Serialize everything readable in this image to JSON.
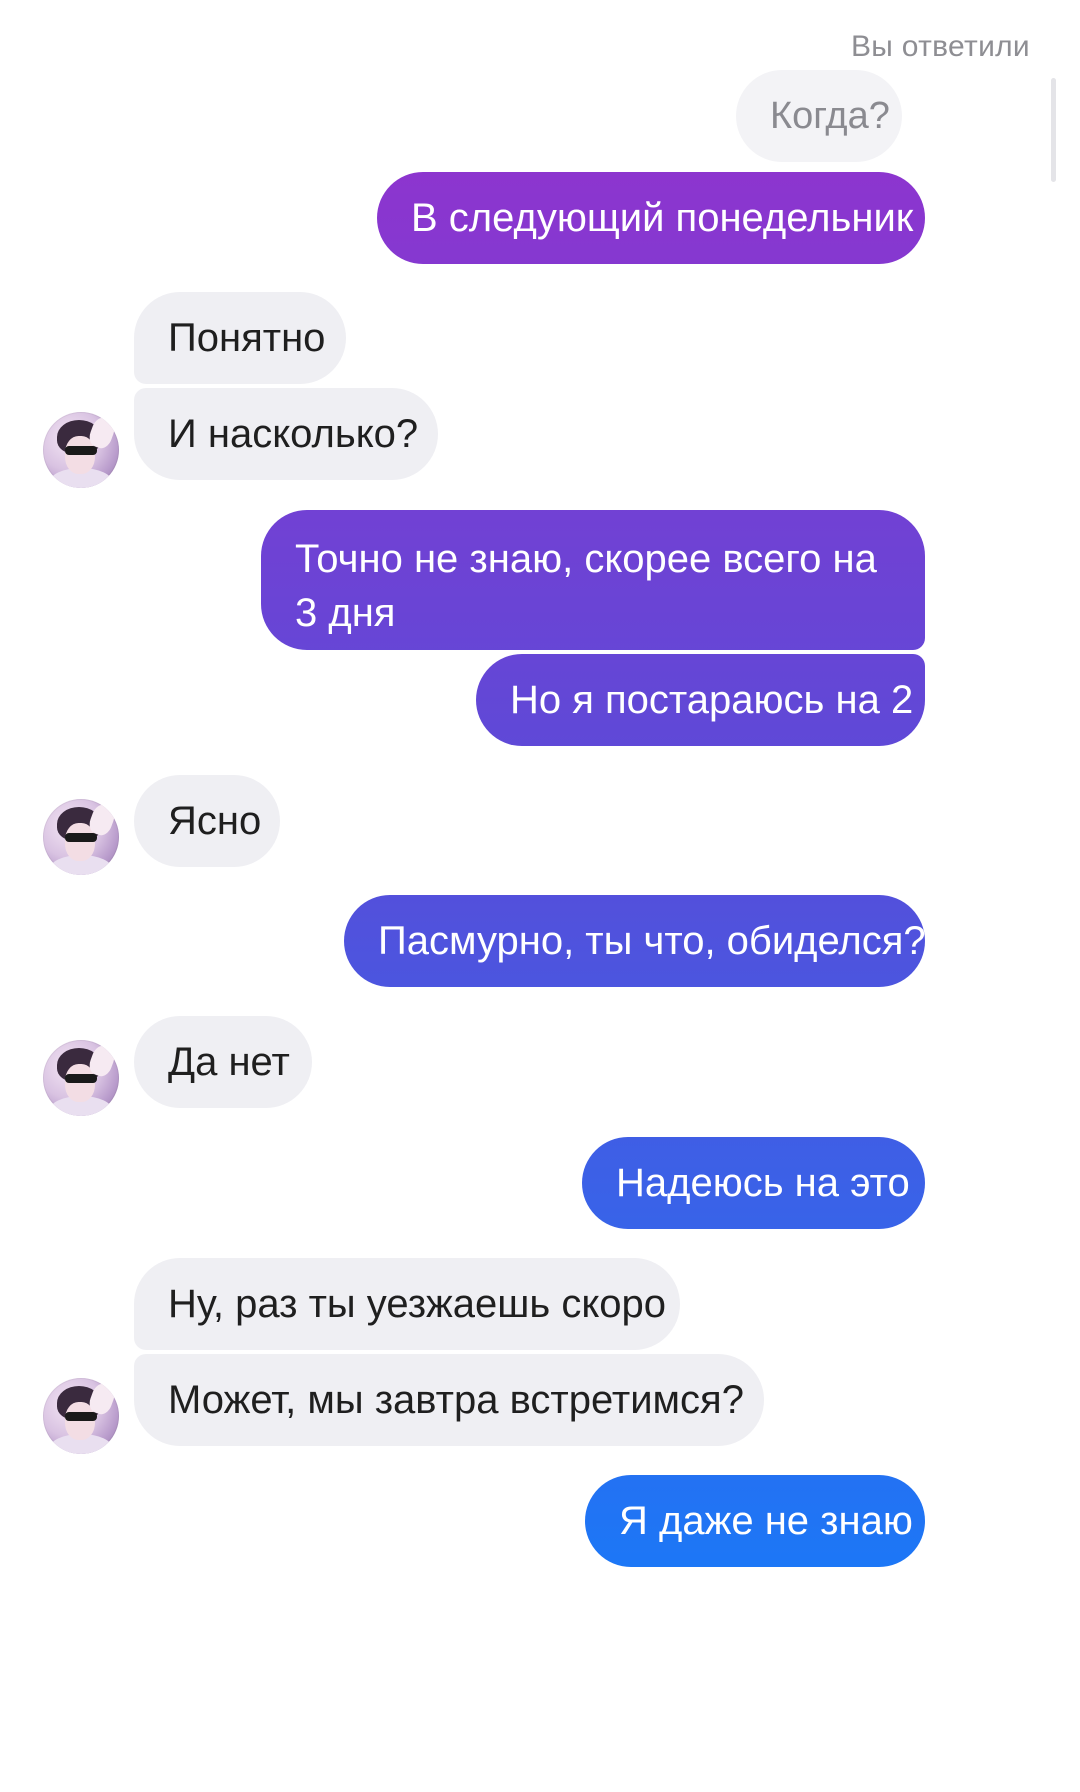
{
  "chat": {
    "reply_note": "Вы ответили",
    "quoted_message": "Когда?",
    "messages": [
      {
        "from": "me",
        "text": "В следующий понедельник"
      },
      {
        "from": "them",
        "text": "Понятно"
      },
      {
        "from": "them",
        "text": "И насколько?"
      },
      {
        "from": "me",
        "text": "Точно не знаю, скорее всего на 3 дня"
      },
      {
        "from": "me",
        "text": "Но я постараюсь на 2"
      },
      {
        "from": "them",
        "text": "Ясно"
      },
      {
        "from": "me",
        "text": "Пасмурно, ты что, обиделся?"
      },
      {
        "from": "them",
        "text": "Да нет"
      },
      {
        "from": "me",
        "text": "Надеюсь на это"
      },
      {
        "from": "them",
        "text": "Ну, раз ты уезжаешь скоро"
      },
      {
        "from": "them",
        "text": "Может, мы завтра встретимся?"
      },
      {
        "from": "me",
        "text": "Я даже не знаю"
      }
    ]
  },
  "colors": {
    "incoming_bubble": "#efeff3",
    "outgoing_gradient_top": "#9a2fcc",
    "outgoing_gradient_mid": "#5a4bd8",
    "outgoing_gradient_bottom": "#0a84ff"
  },
  "icons": {
    "avatar": "contact-avatar-photo"
  }
}
